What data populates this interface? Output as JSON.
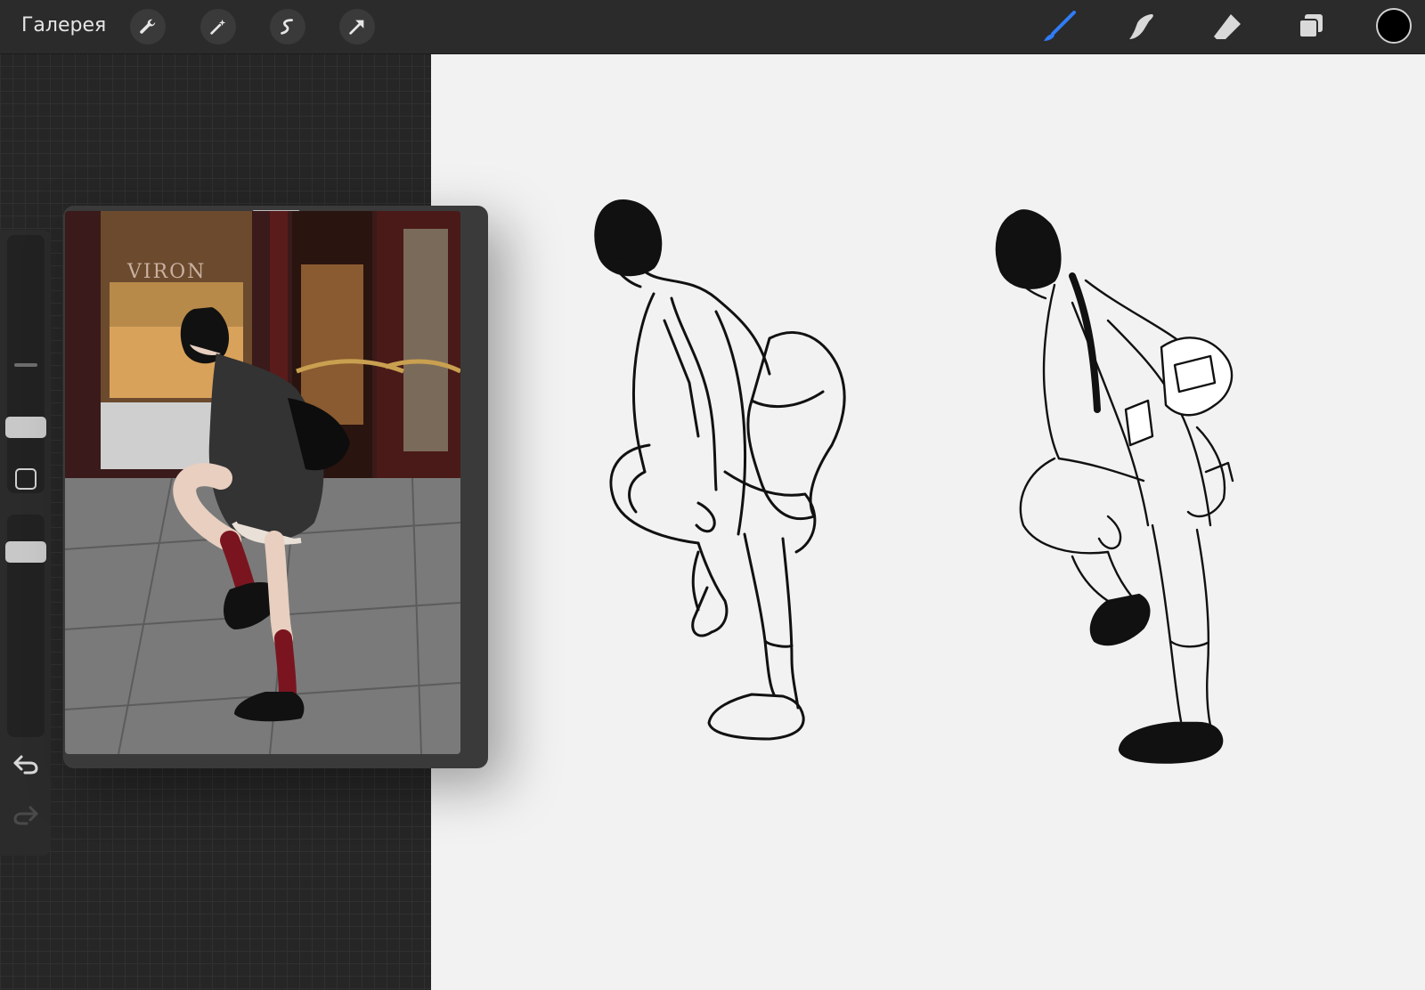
{
  "topbar": {
    "gallery_label": "Галерея",
    "left_tools": [
      "wrench-icon",
      "magic-wand-icon",
      "selection-icon",
      "transform-arrow-icon"
    ],
    "right_tools": [
      "brush-icon",
      "smudge-icon",
      "eraser-icon",
      "layers-icon"
    ],
    "active_tool": "brush-icon",
    "current_color": "#000000",
    "accent_color": "#2f7cf6"
  },
  "sidebar": {
    "brush_size_level": 0.28,
    "opacity_level": 0.6,
    "undo": "undo-icon",
    "redo": "redo-icon"
  },
  "reference": {
    "storefront_text": "VIRON"
  }
}
